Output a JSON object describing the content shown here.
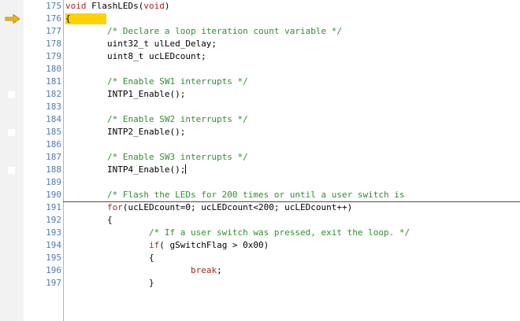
{
  "editor": {
    "lines": [
      {
        "num": "175",
        "text": "void FlashLEDs(void)"
      },
      {
        "num": "176",
        "text": "{"
      },
      {
        "num": "177",
        "text": "        /* Declare a loop iteration count variable */"
      },
      {
        "num": "178",
        "text": "        uint32_t ulLed_Delay;"
      },
      {
        "num": "179",
        "text": "        uint8_t ucLEDcount;"
      },
      {
        "num": "180",
        "text": ""
      },
      {
        "num": "181",
        "text": "        /* Enable SW1 interrupts */"
      },
      {
        "num": "182",
        "text": "        INTP1_Enable();"
      },
      {
        "num": "183",
        "text": ""
      },
      {
        "num": "184",
        "text": "        /* Enable SW2 interrupts */"
      },
      {
        "num": "185",
        "text": "        INTP2_Enable();"
      },
      {
        "num": "186",
        "text": ""
      },
      {
        "num": "187",
        "text": "        /* Enable SW3 interrupts */"
      },
      {
        "num": "188",
        "text": "        INTP4_Enable();"
      },
      {
        "num": "189",
        "text": ""
      },
      {
        "num": "190",
        "text": "        /* Flash the LEDs for 200 times or until a user switch is"
      },
      {
        "num": "191",
        "text": "        for(ucLEDcount=0; ucLEDcount<200; ucLEDcount++)"
      },
      {
        "num": "192",
        "text": "        {"
      },
      {
        "num": "193",
        "text": "                /* If a user switch was pressed, exit the loop. */"
      },
      {
        "num": "194",
        "text": "                if( gSwitchFlag > 0x00)"
      },
      {
        "num": "195",
        "text": "                {"
      },
      {
        "num": "196",
        "text": "                        break;"
      },
      {
        "num": "197",
        "text": "                }"
      }
    ],
    "current_line": "176",
    "colors": {
      "keyword": "#b22222",
      "comment": "#2f8f2f",
      "line_number": "#4d7ab8",
      "current_line_highlight": "#ffd200",
      "pc_arrow": "#f5b800"
    },
    "icons": {
      "pc_marker": "arrow-right-icon",
      "breakpoint_slot": "breakpoint-marker-icon"
    }
  }
}
